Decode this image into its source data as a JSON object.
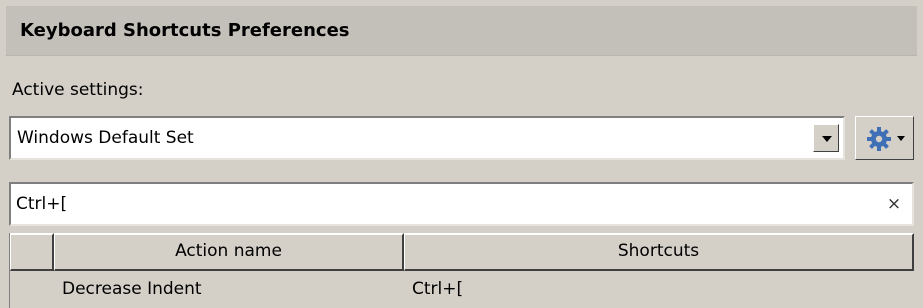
{
  "panel": {
    "title": "Keyboard Shortcuts Preferences"
  },
  "active_settings": {
    "label": "Active settings:",
    "selected_value": "Windows Default Set"
  },
  "filter": {
    "value": "Ctrl+[",
    "clear_glyph": "×"
  },
  "table": {
    "columns": [
      "Action name",
      "Shortcuts"
    ],
    "rows": [
      {
        "action": "Decrease Indent",
        "shortcut": "Ctrl+["
      }
    ]
  },
  "icons": {
    "settings_menu": "gear-icon",
    "dropdown": "chevron-down-icon",
    "clear": "close-icon"
  },
  "colors": {
    "background": "#d4d0c8",
    "title_bar": "#c3c0b9",
    "gear": "#3f6fb5"
  }
}
